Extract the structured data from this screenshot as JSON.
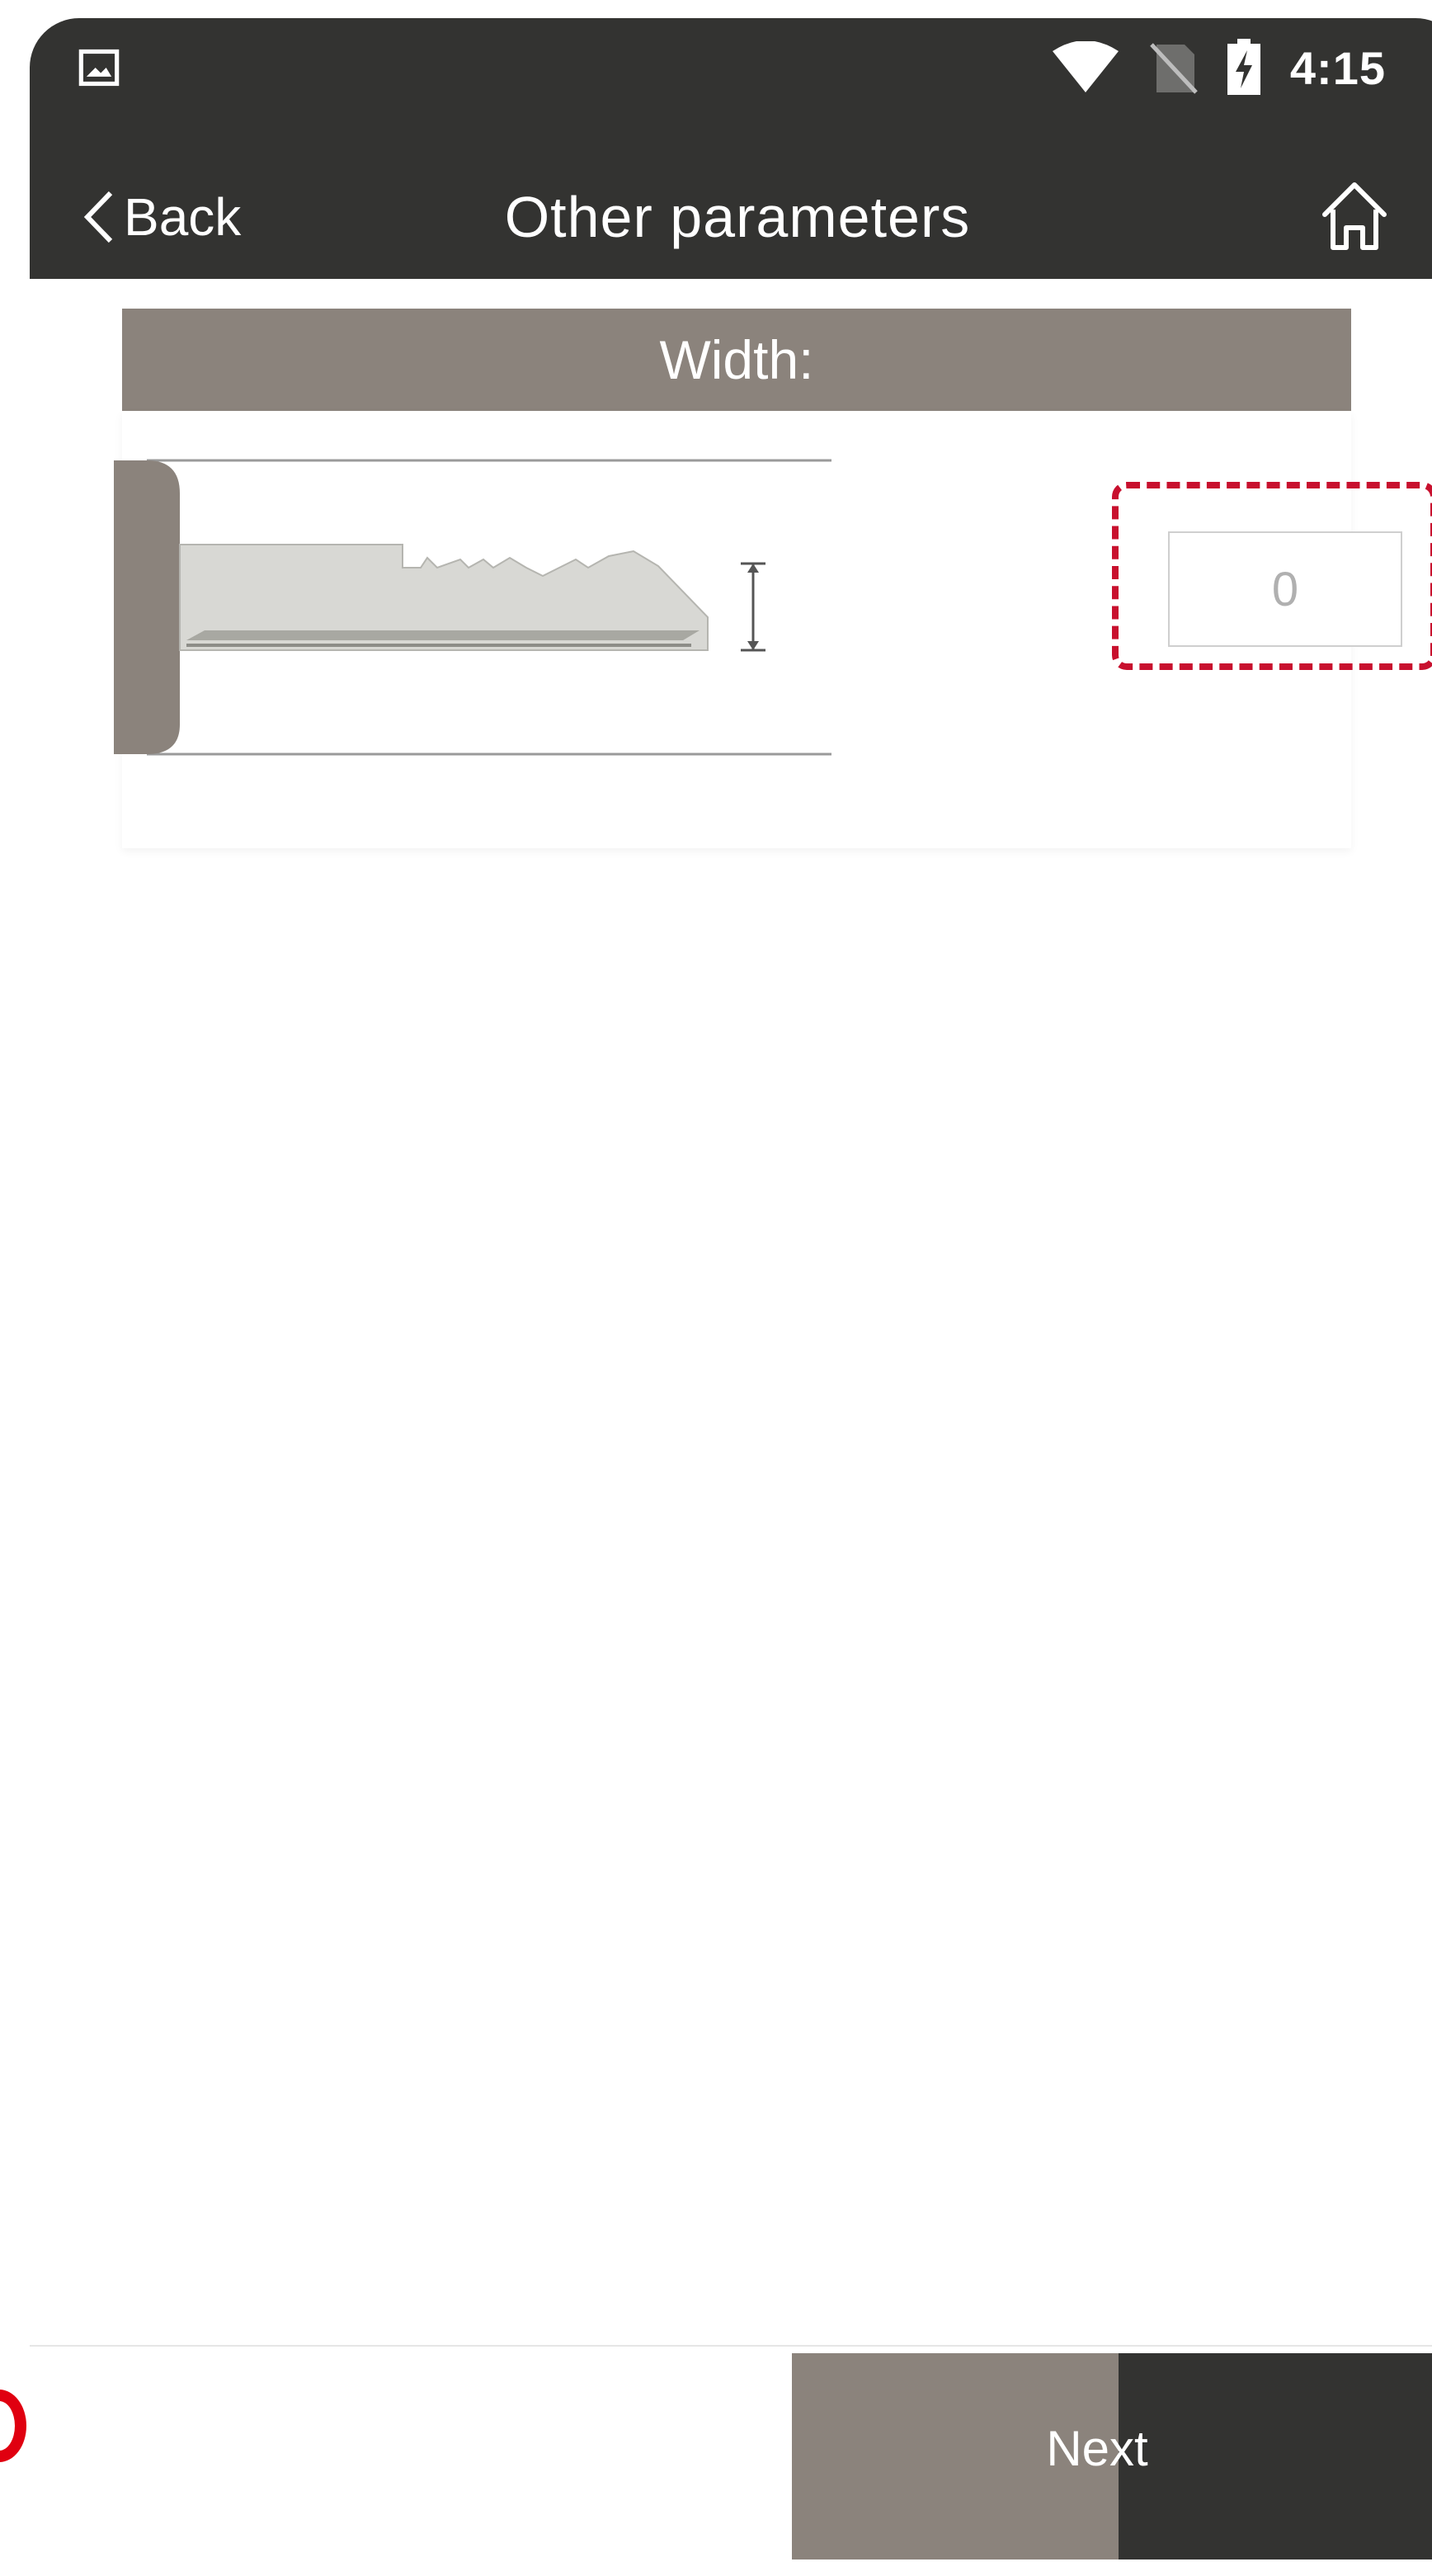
{
  "status_bar": {
    "time": "4:15",
    "icons": [
      "image-notification-icon",
      "wifi-icon",
      "no-sim-icon",
      "battery-charging-icon"
    ]
  },
  "nav": {
    "back_label": "Back",
    "title": "Other parameters",
    "home_icon": "home-icon"
  },
  "section": {
    "header": "Width:",
    "value": "0"
  },
  "footer": {
    "next_label": "Next"
  },
  "colors": {
    "topbar": "#333331",
    "header": "#8b837c",
    "highlight": "#c8102e"
  }
}
